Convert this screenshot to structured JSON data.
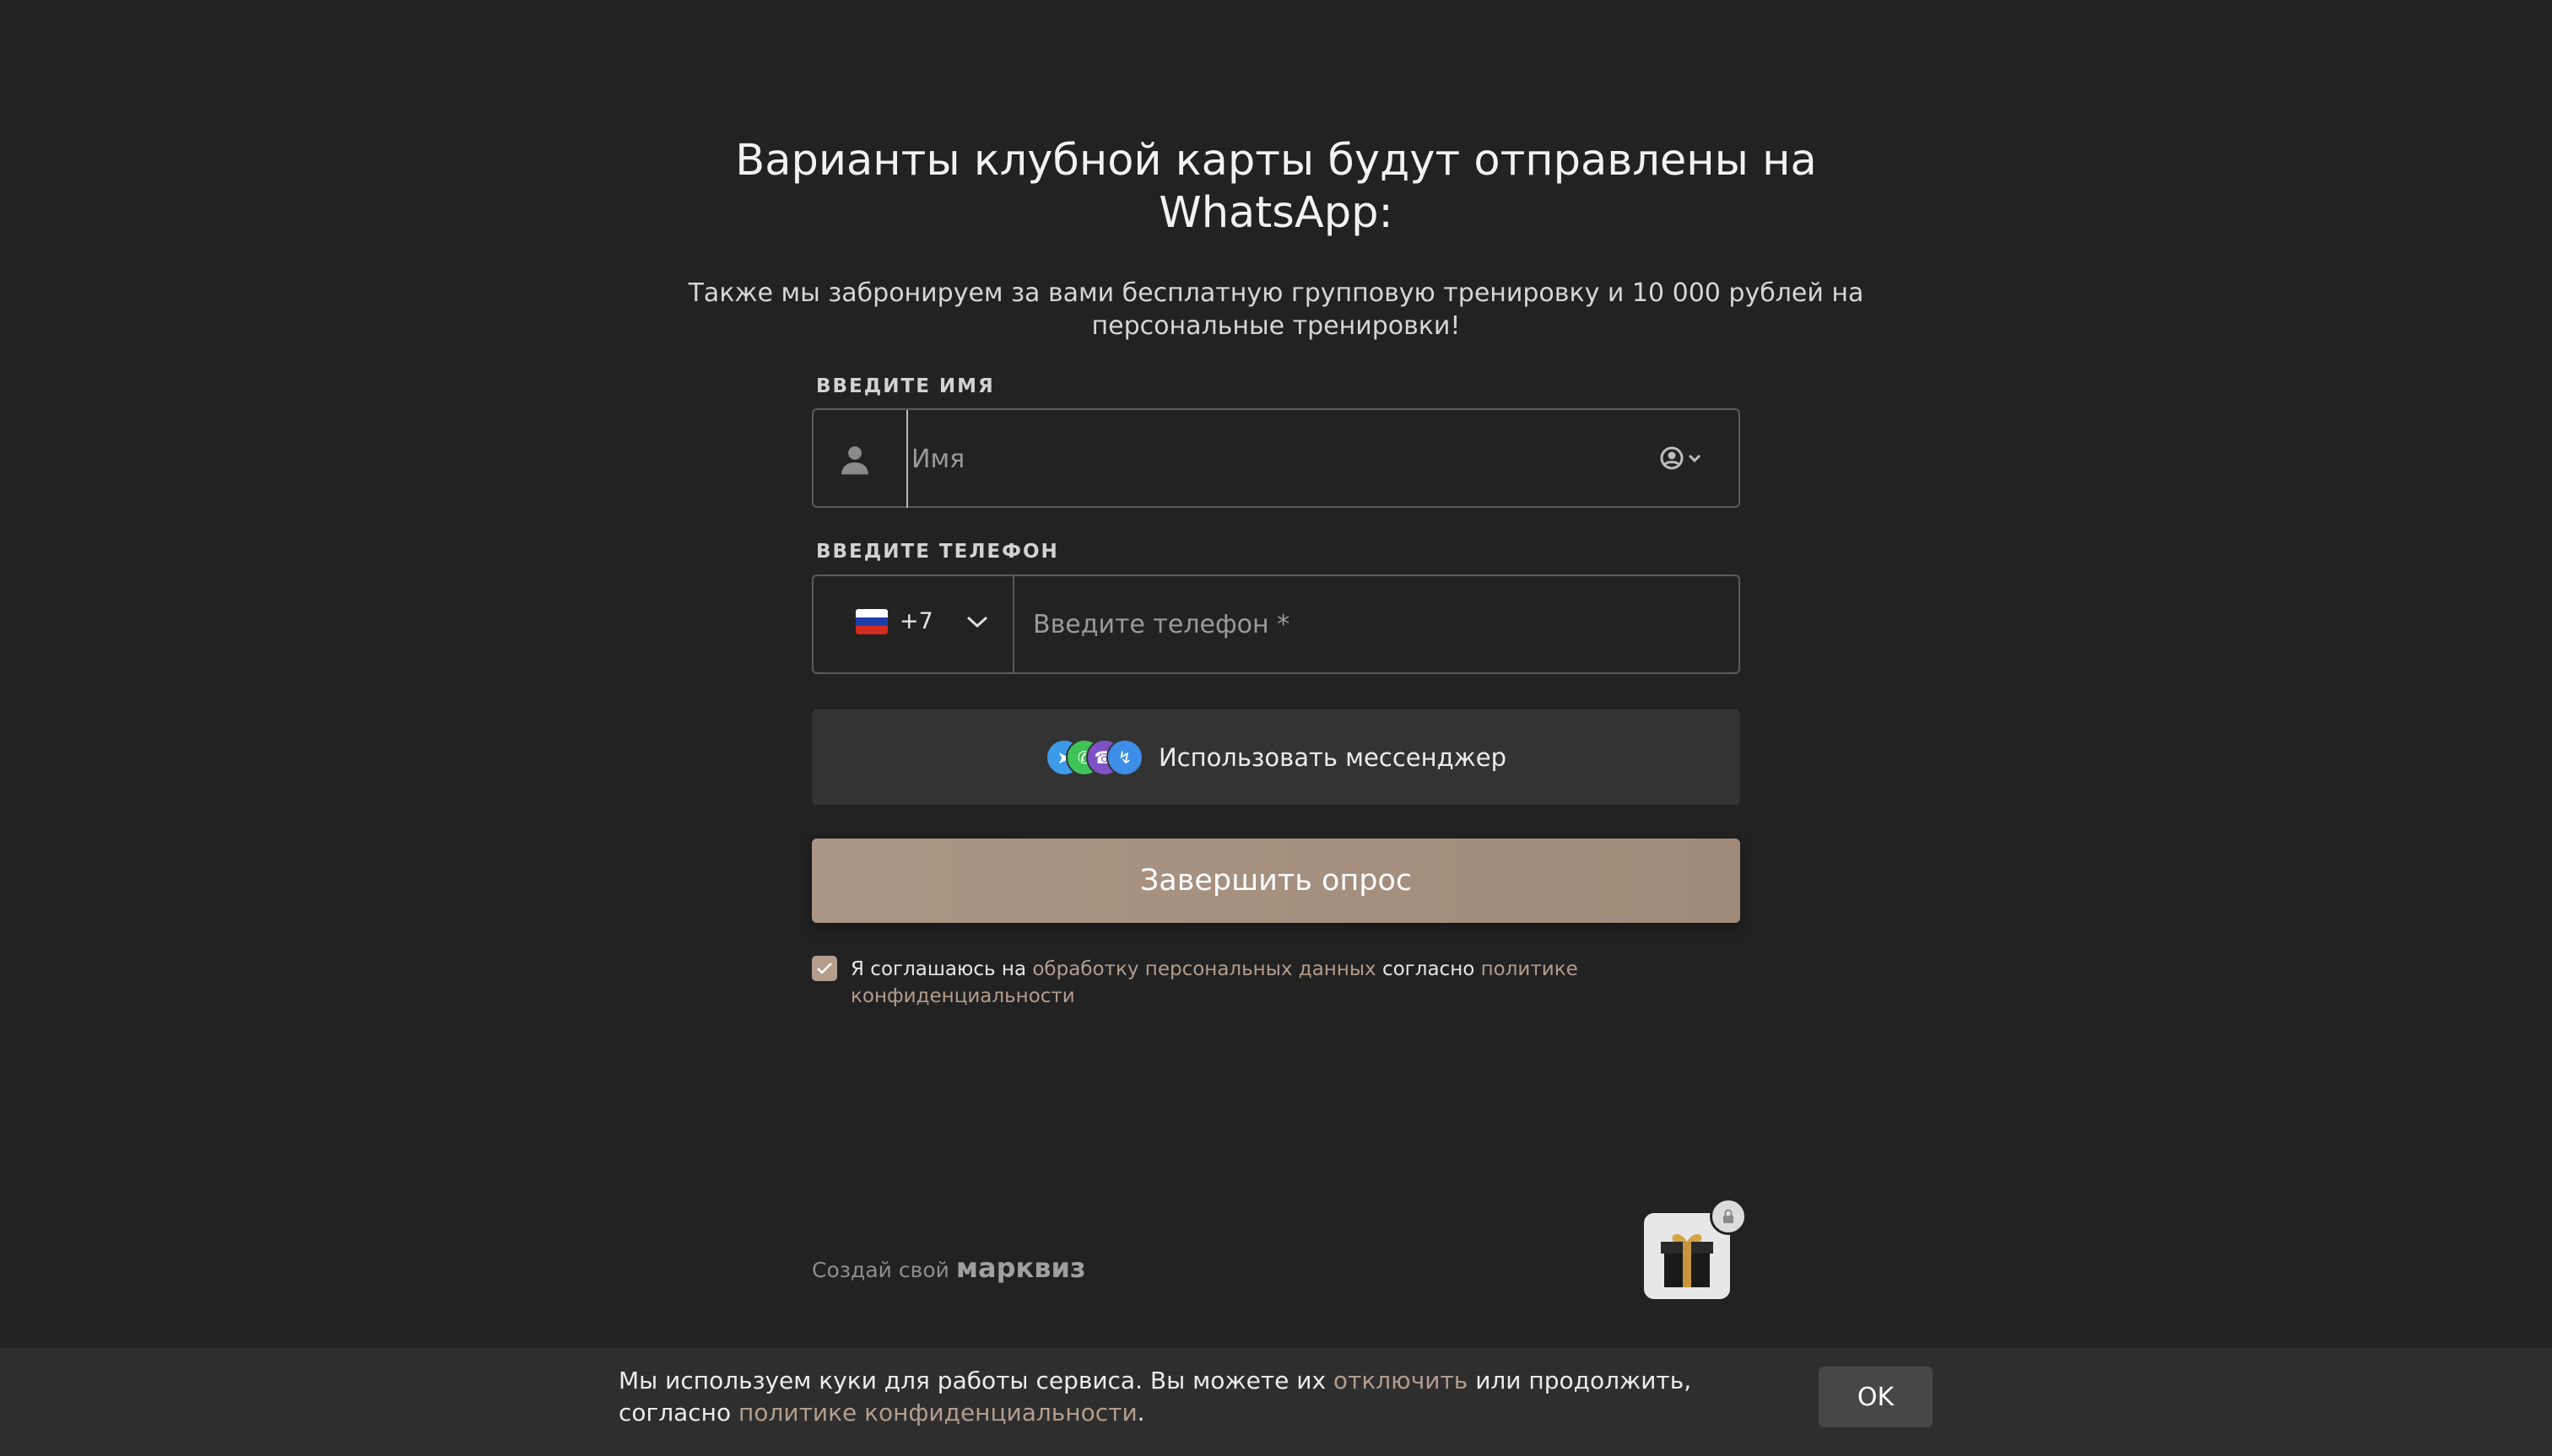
{
  "form": {
    "title": "Варианты клубной карты будут отправлены на WhatsApp:",
    "subtitle": "Также мы забронируем за вами бесплатную групповую тренировку и 10 000 рублей на персональные тренировки!",
    "name_label": "ВВЕДИТЕ ИМЯ",
    "name_placeholder": "Имя",
    "phone_label": "ВВЕДИТЕ ТЕЛЕФОН",
    "country_code": "+7",
    "phone_placeholder": "Введите телефон *",
    "messenger_button": "Использовать мессенджер",
    "submit_button": "Завершить опрос",
    "consent": {
      "checked": true,
      "text_1": "Я соглашаюсь на ",
      "link_1": "обработку персональных данных",
      "text_2": " согласно ",
      "link_2": "политике конфиденциальности"
    }
  },
  "footer": {
    "brand_prefix": "Создай свой ",
    "brand_name": "марквиз"
  },
  "cookie_bar": {
    "text_1": "Мы используем куки для работы сервиса. Вы можете их ",
    "link_1": "отключить",
    "text_2": " или продолжить, согласно ",
    "link_2": "политике конфиденциальности",
    "text_3": ".",
    "ok_button": "OK"
  },
  "colors": {
    "background": "#222222",
    "accent": "#b39d8c",
    "submit": "#a8927f"
  },
  "icons": [
    "user-icon",
    "autofill-contact-icon",
    "russia-flag-icon",
    "chevron-down-icon",
    "telegram-icon",
    "whatsapp-icon",
    "viber-icon",
    "messenger-icon",
    "checkmark-icon",
    "gift-icon",
    "lock-icon"
  ]
}
